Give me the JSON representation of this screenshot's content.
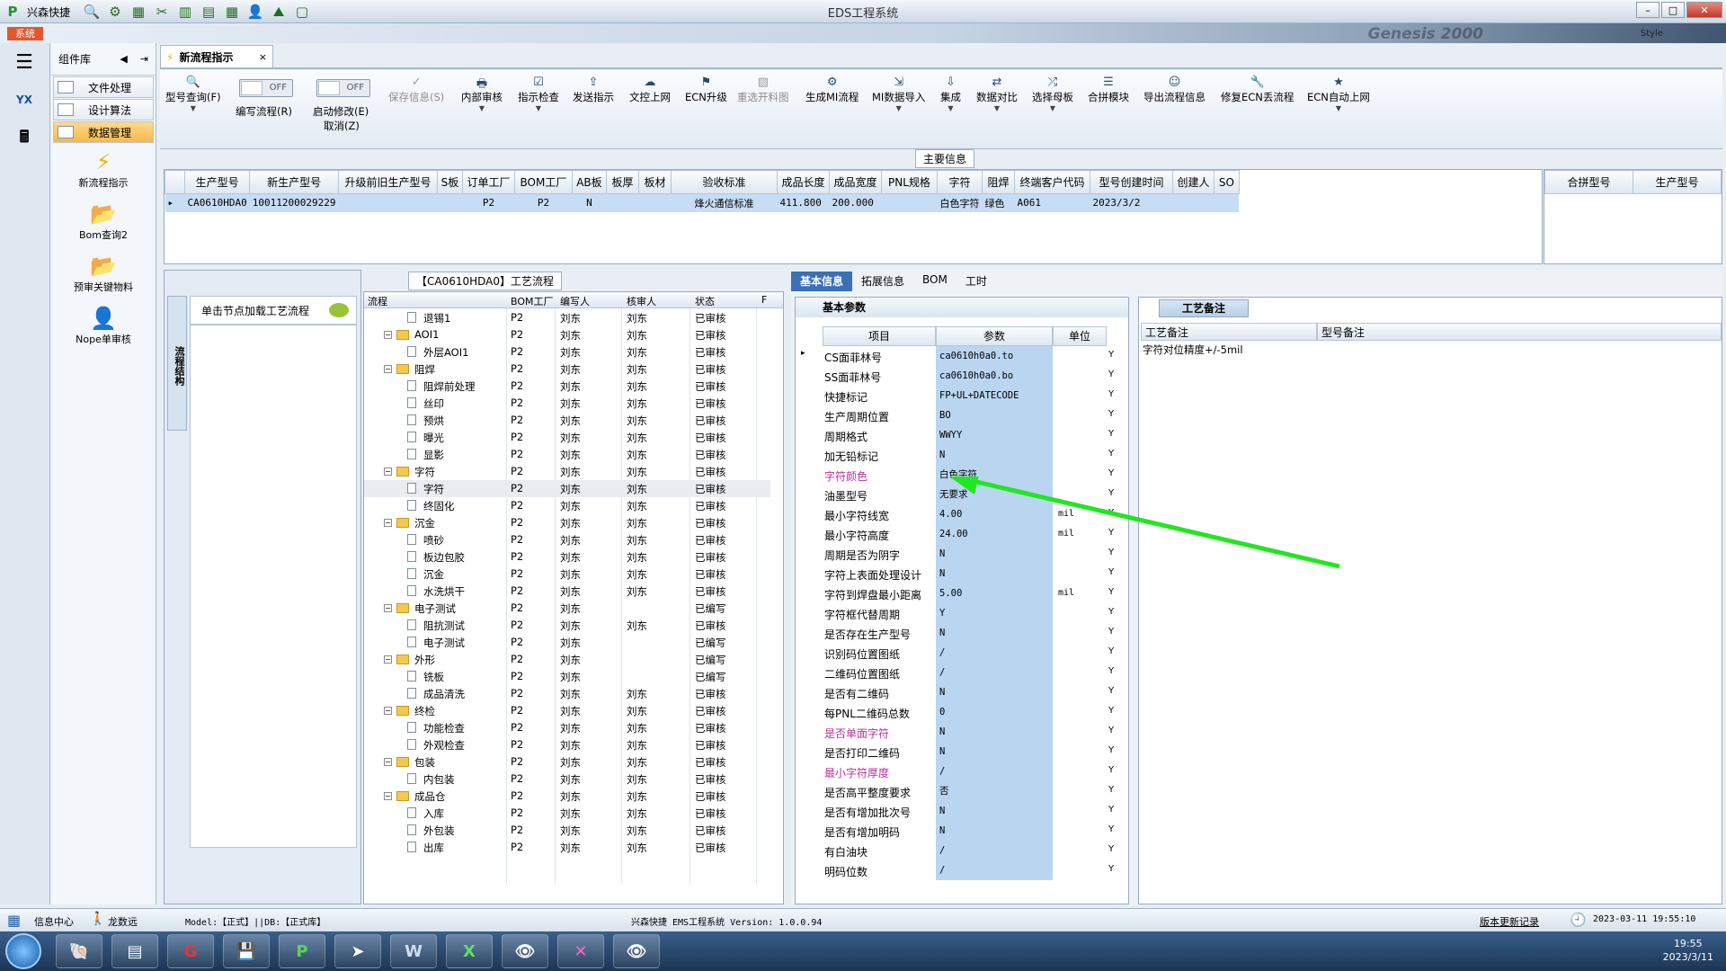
{
  "window": {
    "app_name": "兴森快捷",
    "title": "EDS工程系统",
    "sys_tab": "系统",
    "style_label": "Style",
    "watermark": "Genesis 2000"
  },
  "left_panel": {
    "header": "组件库",
    "categories": [
      "文件处理",
      "设计算法",
      "数据管理"
    ],
    "tools": [
      "新流程指示",
      "Bom查询2",
      "预审关键物料",
      "Nope单审核"
    ]
  },
  "doc_tab": {
    "label": "新流程指示",
    "close": "×"
  },
  "ribbon": {
    "model_query": "型号查询(F)",
    "write_flow": "编写流程(R)",
    "start_modify": "启动修改(E)",
    "cancel": "取消(Z)",
    "off_label": "OFF",
    "save_info": "保存信息(S)",
    "internal_review": "内部审核",
    "indicator_check": "指示检查",
    "send_indicator": "发送指示",
    "doc_online": "文控上网",
    "ecn_upgrade": "ECN升级",
    "reselect_drawing": "重选开料图",
    "gen_mi_flow": "生成MI流程",
    "mi_data_import": "MI数据导入",
    "integrate": "集成",
    "data_compare": "数据对比",
    "select_master": "选择母板",
    "merge_module": "合拼模块",
    "export_flow": "导出流程信息",
    "repair_ecn": "修复ECN丢流程",
    "ecn_auto": "ECN自动上网"
  },
  "main_info": {
    "caption": "主要信息",
    "columns": [
      "生产型号",
      "新生产型号",
      "升级前旧生产型号",
      "S板",
      "订单工厂",
      "BOM工厂",
      "AB板",
      "板厚",
      "板材",
      "验收标准",
      "成品长度",
      "成品宽度",
      "PNL规格",
      "字符",
      "阻焊",
      "终端客户代码",
      "型号创建时间",
      "创建人",
      "SO"
    ],
    "row": [
      "CA0610HDA0",
      "10011200029229",
      "",
      "",
      "P2",
      "P2",
      "N",
      "",
      "",
      "烽火通信标准",
      "411.800",
      "200.000",
      "",
      "白色字符",
      "绿色",
      "A061",
      "2023/3/2",
      "",
      ""
    ],
    "right_columns": [
      "合拼型号",
      "生产型号"
    ]
  },
  "process_flow": {
    "caption": "【CA0610HDA0】工艺流程",
    "side_tab": "流程结构",
    "node_hint": "单击节点加载工艺流程",
    "columns": [
      "流程",
      "BOM工厂",
      "编写人",
      "核审人",
      "状态",
      "F"
    ],
    "rows": [
      {
        "level": 2,
        "name": "退锡1",
        "bom": "P2",
        "writer": "刘东",
        "reviewer": "刘东",
        "status": "已审核"
      },
      {
        "level": 1,
        "name": "AOI1",
        "bom": "P2",
        "writer": "刘东",
        "reviewer": "刘东",
        "status": "已审核"
      },
      {
        "level": 2,
        "name": "外层AOI1",
        "bom": "P2",
        "writer": "刘东",
        "reviewer": "刘东",
        "status": "已审核"
      },
      {
        "level": 1,
        "name": "阻焊",
        "bom": "P2",
        "writer": "刘东",
        "reviewer": "刘东",
        "status": "已审核"
      },
      {
        "level": 2,
        "name": "阻焊前处理",
        "bom": "P2",
        "writer": "刘东",
        "reviewer": "刘东",
        "status": "已审核"
      },
      {
        "level": 2,
        "name": "丝印",
        "bom": "P2",
        "writer": "刘东",
        "reviewer": "刘东",
        "status": "已审核"
      },
      {
        "level": 2,
        "name": "预烘",
        "bom": "P2",
        "writer": "刘东",
        "reviewer": "刘东",
        "status": "已审核"
      },
      {
        "level": 2,
        "name": "曝光",
        "bom": "P2",
        "writer": "刘东",
        "reviewer": "刘东",
        "status": "已审核"
      },
      {
        "level": 2,
        "name": "显影",
        "bom": "P2",
        "writer": "刘东",
        "reviewer": "刘东",
        "status": "已审核"
      },
      {
        "level": 1,
        "name": "字符",
        "bom": "P2",
        "writer": "刘东",
        "reviewer": "刘东",
        "status": "已审核"
      },
      {
        "level": 2,
        "name": "字符",
        "bom": "P2",
        "writer": "刘东",
        "reviewer": "刘东",
        "status": "已审核"
      },
      {
        "level": 2,
        "name": "终固化",
        "bom": "P2",
        "writer": "刘东",
        "reviewer": "刘东",
        "status": "已审核"
      },
      {
        "level": 1,
        "name": "沉金",
        "bom": "P2",
        "writer": "刘东",
        "reviewer": "刘东",
        "status": "已审核"
      },
      {
        "level": 2,
        "name": "喷砂",
        "bom": "P2",
        "writer": "刘东",
        "reviewer": "刘东",
        "status": "已审核"
      },
      {
        "level": 2,
        "name": "板边包胶",
        "bom": "P2",
        "writer": "刘东",
        "reviewer": "刘东",
        "status": "已审核"
      },
      {
        "level": 2,
        "name": "沉金",
        "bom": "P2",
        "writer": "刘东",
        "reviewer": "刘东",
        "status": "已审核"
      },
      {
        "level": 2,
        "name": "水洗烘干",
        "bom": "P2",
        "writer": "刘东",
        "reviewer": "刘东",
        "status": "已审核"
      },
      {
        "level": 1,
        "name": "电子测试",
        "bom": "P2",
        "writer": "刘东",
        "reviewer": "",
        "status": "已编写"
      },
      {
        "level": 2,
        "name": "阻抗测试",
        "bom": "P2",
        "writer": "刘东",
        "reviewer": "刘东",
        "status": "已审核"
      },
      {
        "level": 2,
        "name": "电子测试",
        "bom": "P2",
        "writer": "刘东",
        "reviewer": "",
        "status": "已编写"
      },
      {
        "level": 1,
        "name": "外形",
        "bom": "P2",
        "writer": "刘东",
        "reviewer": "",
        "status": "已编写"
      },
      {
        "level": 2,
        "name": "铣板",
        "bom": "P2",
        "writer": "刘东",
        "reviewer": "",
        "status": "已编写"
      },
      {
        "level": 2,
        "name": "成品清洗",
        "bom": "P2",
        "writer": "刘东",
        "reviewer": "刘东",
        "status": "已审核"
      },
      {
        "level": 1,
        "name": "终检",
        "bom": "P2",
        "writer": "刘东",
        "reviewer": "刘东",
        "status": "已审核"
      },
      {
        "level": 2,
        "name": "功能检查",
        "bom": "P2",
        "writer": "刘东",
        "reviewer": "刘东",
        "status": "已审核"
      },
      {
        "level": 2,
        "name": "外观检查",
        "bom": "P2",
        "writer": "刘东",
        "reviewer": "刘东",
        "status": "已审核"
      },
      {
        "level": 1,
        "name": "包装",
        "bom": "P2",
        "writer": "刘东",
        "reviewer": "刘东",
        "status": "已审核"
      },
      {
        "level": 2,
        "name": "内包装",
        "bom": "P2",
        "writer": "刘东",
        "reviewer": "刘东",
        "status": "已审核"
      },
      {
        "level": 1,
        "name": "成品仓",
        "bom": "P2",
        "writer": "刘东",
        "reviewer": "刘东",
        "status": "已审核"
      },
      {
        "level": 2,
        "name": "入库",
        "bom": "P2",
        "writer": "刘东",
        "reviewer": "刘东",
        "status": "已审核"
      },
      {
        "level": 2,
        "name": "外包装",
        "bom": "P2",
        "writer": "刘东",
        "reviewer": "刘东",
        "status": "已审核"
      },
      {
        "level": 2,
        "name": "出库",
        "bom": "P2",
        "writer": "刘东",
        "reviewer": "刘东",
        "status": "已审核"
      }
    ]
  },
  "right_tabs": [
    "基本信息",
    "拓展信息",
    "BOM",
    "工时"
  ],
  "basic_params": {
    "caption": "基本参数",
    "columns": [
      "项目",
      "参数",
      "单位"
    ],
    "rows": [
      {
        "name": "CS面菲林号",
        "value": "ca0610h0a0.to",
        "unit": "",
        "flag": "Y"
      },
      {
        "name": "SS面菲林号",
        "value": "ca0610h0a0.bo",
        "unit": "",
        "flag": "Y"
      },
      {
        "name": "快捷标记",
        "value": "FP+UL+DATECODE",
        "unit": "",
        "flag": "Y"
      },
      {
        "name": "生产周期位置",
        "value": "BO",
        "unit": "",
        "flag": "Y"
      },
      {
        "name": "周期格式",
        "value": "WWYY",
        "unit": "",
        "flag": "Y"
      },
      {
        "name": "加无铅标记",
        "value": "N",
        "unit": "",
        "flag": "Y"
      },
      {
        "name": "字符颜色",
        "value": "白色字符",
        "unit": "",
        "flag": "Y",
        "pink": true
      },
      {
        "name": "油墨型号",
        "value": "无要求",
        "unit": "",
        "flag": "Y"
      },
      {
        "name": "最小字符线宽",
        "value": "4.00",
        "unit": "mil",
        "flag": "Y"
      },
      {
        "name": "最小字符高度",
        "value": "24.00",
        "unit": "mil",
        "flag": "Y"
      },
      {
        "name": "周期是否为阴字",
        "value": "N",
        "unit": "",
        "flag": "Y"
      },
      {
        "name": "字符上表面处理设计",
        "value": "N",
        "unit": "",
        "flag": "Y"
      },
      {
        "name": "字符到焊盘最小距离",
        "value": "5.00",
        "unit": "mil",
        "flag": "Y"
      },
      {
        "name": "字符框代替周期",
        "value": "Y",
        "unit": "",
        "flag": "Y"
      },
      {
        "name": "是否存在生产型号",
        "value": "N",
        "unit": "",
        "flag": "Y"
      },
      {
        "name": "识别码位置图纸",
        "value": "/",
        "unit": "",
        "flag": "Y"
      },
      {
        "name": "二维码位置图纸",
        "value": "/",
        "unit": "",
        "flag": "Y"
      },
      {
        "name": "是否有二维码",
        "value": "N",
        "unit": "",
        "flag": "Y"
      },
      {
        "name": "每PNL二维码总数",
        "value": "0",
        "unit": "",
        "flag": "Y"
      },
      {
        "name": "是否单面字符",
        "value": "N",
        "unit": "",
        "flag": "Y",
        "pink": true
      },
      {
        "name": "是否打印二维码",
        "value": "N",
        "unit": "",
        "flag": "Y"
      },
      {
        "name": "最小字符厚度",
        "value": "/",
        "unit": "",
        "flag": "Y",
        "pink": true
      },
      {
        "name": "是否高平整度要求",
        "value": "否",
        "unit": "",
        "flag": "Y"
      },
      {
        "name": "是否有增加批次号",
        "value": "N",
        "unit": "",
        "flag": "Y"
      },
      {
        "name": "是否有增加明码",
        "value": "N",
        "unit": "",
        "flag": "Y"
      },
      {
        "name": "有白油块",
        "value": "/",
        "unit": "",
        "flag": "Y"
      },
      {
        "name": "明码位数",
        "value": "/",
        "unit": "",
        "flag": "Y"
      }
    ]
  },
  "craft_notes": {
    "tab": "工艺备注",
    "col1": "工艺备注",
    "col2": "型号备注",
    "note": "字符对位精度+/-5mil"
  },
  "status_bar": {
    "info_center": "信息中心",
    "user": "龙数远",
    "model_db": "Model:【正式】||DB:【正式库】",
    "version": "兴森快捷 EMS工程系统 Version: 1.0.0.94",
    "update_log": "版本更新记录",
    "datetime": "2023-03-11 19:55:10"
  },
  "taskbar": {
    "time": "19:55",
    "date": "2023/3/11"
  },
  "colors": {
    "accent": "#3b6fb6",
    "param_bg": "#b9d5f0",
    "arrow": "#22e622",
    "pink": "#b3339a"
  }
}
